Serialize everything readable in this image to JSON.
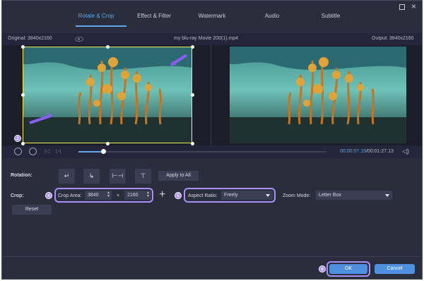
{
  "tabs": [
    {
      "label": "Rotate & Crop",
      "active": true
    },
    {
      "label": "Effect & Filter"
    },
    {
      "label": "Watermark"
    },
    {
      "label": "Audio"
    },
    {
      "label": "Subtitle"
    }
  ],
  "window": {
    "restore_icon": "□",
    "close_icon": "×"
  },
  "info": {
    "original": "Original: 3840x2160",
    "filename": "my blu-ray Movie 200(1).mp4",
    "output": "Output: 3840x2160"
  },
  "playback": {
    "current_time": "00:00:07.15",
    "total_time": "/00:01:27.13",
    "progress": 0.1
  },
  "rotation": {
    "label": "Rotation:",
    "apply_all": "Apply to All",
    "icons": [
      "↵",
      "↳",
      "⊢⊣",
      "⊤"
    ]
  },
  "crop": {
    "label": "Crop:",
    "area_label": "Crop Area:",
    "width": "3840",
    "times": "×",
    "height": "2160",
    "reset": "Reset"
  },
  "aspect": {
    "label": "Aspect Ratio:",
    "value": "Freely"
  },
  "zoom": {
    "label": "Zoom Mode:",
    "value": "Letter Box"
  },
  "badges": {
    "b2": "2",
    "b4": "4",
    "b5": "5",
    "b6": "6"
  },
  "footer": {
    "ok": "OK",
    "cancel": "Cancel"
  },
  "colors": {
    "accent": "#5fa8f0",
    "highlight": "#a98ff7",
    "crop": "#ffea5c"
  }
}
